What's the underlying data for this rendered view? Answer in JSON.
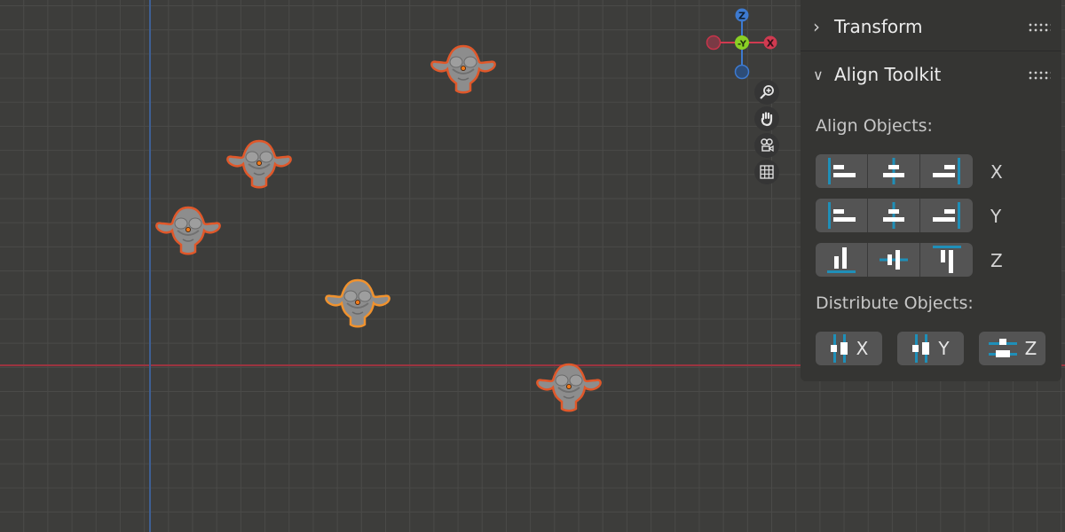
{
  "viewport": {
    "gizmo": {
      "z": "Z",
      "y": "-Y",
      "x": "X"
    },
    "nav_icons": [
      "zoom-icon",
      "pan-hand-icon",
      "camera-icon",
      "grid-ortho-icon"
    ],
    "colors": {
      "x_axis": "#9b3440",
      "y_axis": "#3e5f93",
      "selected_outline": "#e0582a",
      "active_outline": "#f0922e"
    }
  },
  "panel": {
    "transform": {
      "title": "Transform",
      "collapsed": true
    },
    "align_toolkit": {
      "title": "Align Toolkit",
      "collapsed": false,
      "align_label": "Align Objects:",
      "axes": [
        "X",
        "Y",
        "Z"
      ],
      "distribute_label": "Distribute Objects:",
      "distribute": [
        "X",
        "Y",
        "Z"
      ]
    },
    "accent": "#1f8fb8"
  }
}
